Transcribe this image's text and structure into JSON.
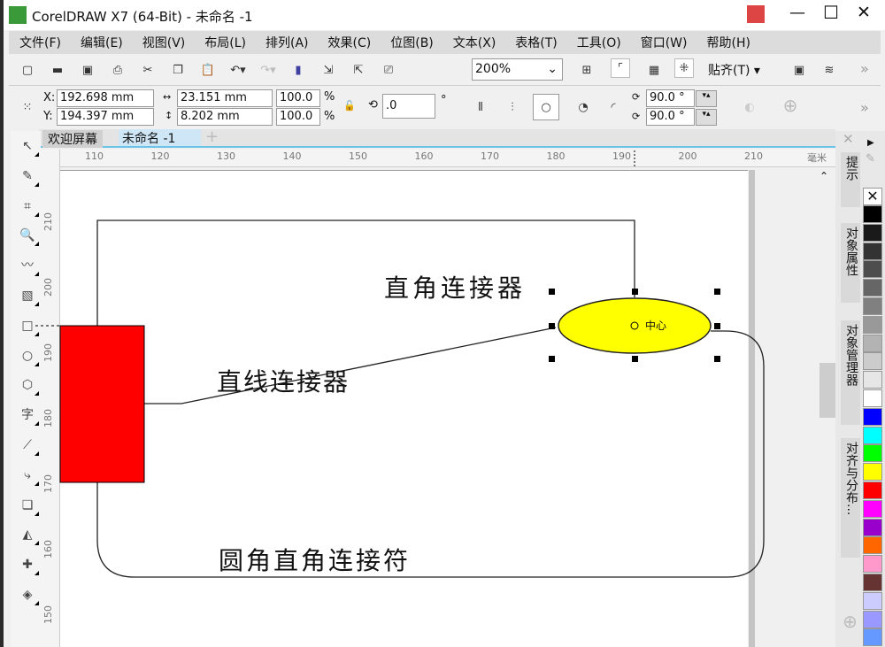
{
  "window": {
    "title": "CorelDRAW X7 (64-Bit) - 未命名 -1",
    "minimize": "—",
    "maximize": "☐",
    "close": "✕"
  },
  "menu": [
    "文件(F)",
    "编辑(E)",
    "视图(V)",
    "布局(L)",
    "排列(A)",
    "效果(C)",
    "位图(B)",
    "文本(X)",
    "表格(T)",
    "工具(O)",
    "窗口(W)",
    "帮助(H)"
  ],
  "toolbar": {
    "zoom": "200%",
    "snap": "贴齐(T)",
    "more": "»"
  },
  "properties": {
    "x_label": "X:",
    "x": "192.698 mm",
    "y_label": "Y:",
    "y": "194.397 mm",
    "width": "23.151 mm",
    "height": "8.202 mm",
    "scale_x": "100.0",
    "scale_y": "100.0",
    "pct": "%",
    "rotation": ".0",
    "deg": "°",
    "start_angle": "90.0 °",
    "end_angle": "90.0 °"
  },
  "tabs": {
    "welcome": "欢迎屏幕",
    "doc": "未命名 -1",
    "add": "+"
  },
  "ruler": {
    "unit": "毫米",
    "h": [
      "110",
      "120",
      "130",
      "140",
      "150",
      "160",
      "170",
      "180",
      "190",
      "200",
      "210"
    ],
    "v": [
      "210",
      "200",
      "190",
      "180",
      "170",
      "160",
      "150"
    ]
  },
  "canvas": {
    "label_right_angle": "直角连接器",
    "label_straight": "直线连接器",
    "label_rounded": "圆角直角连接符",
    "center": "中心",
    "ellipse_fill": "#ffff00",
    "rect_fill": "#ff0000"
  },
  "dockers": [
    "提示",
    "对象属性",
    "对象管理器",
    "对齐与分布..."
  ],
  "palette": [
    "#000000",
    "#1a1a1a",
    "#333333",
    "#4d4d4d",
    "#666666",
    "#808080",
    "#999999",
    "#b3b3b3",
    "#cccccc",
    "#e6e6e6",
    "#ffffff",
    "#0000ff",
    "#00ffff",
    "#00ff00",
    "#ffff00",
    "#ff0000",
    "#ff00ff",
    "#9900cc",
    "#ff6600",
    "#ff99cc",
    "#663333",
    "#ccccff",
    "#9999ff",
    "#6699ff"
  ]
}
